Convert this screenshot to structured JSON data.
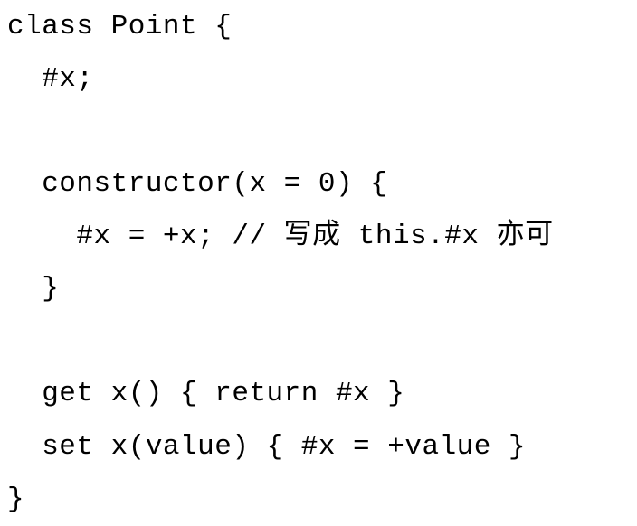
{
  "code": {
    "lines": [
      "class Point {",
      "  #x;",
      "",
      "  constructor(x = 0) {",
      "    #x = +x; // 写成 this.#x 亦可",
      "  }",
      "",
      "  get x() { return #x }",
      "  set x(value) { #x = +value }",
      "}"
    ]
  }
}
